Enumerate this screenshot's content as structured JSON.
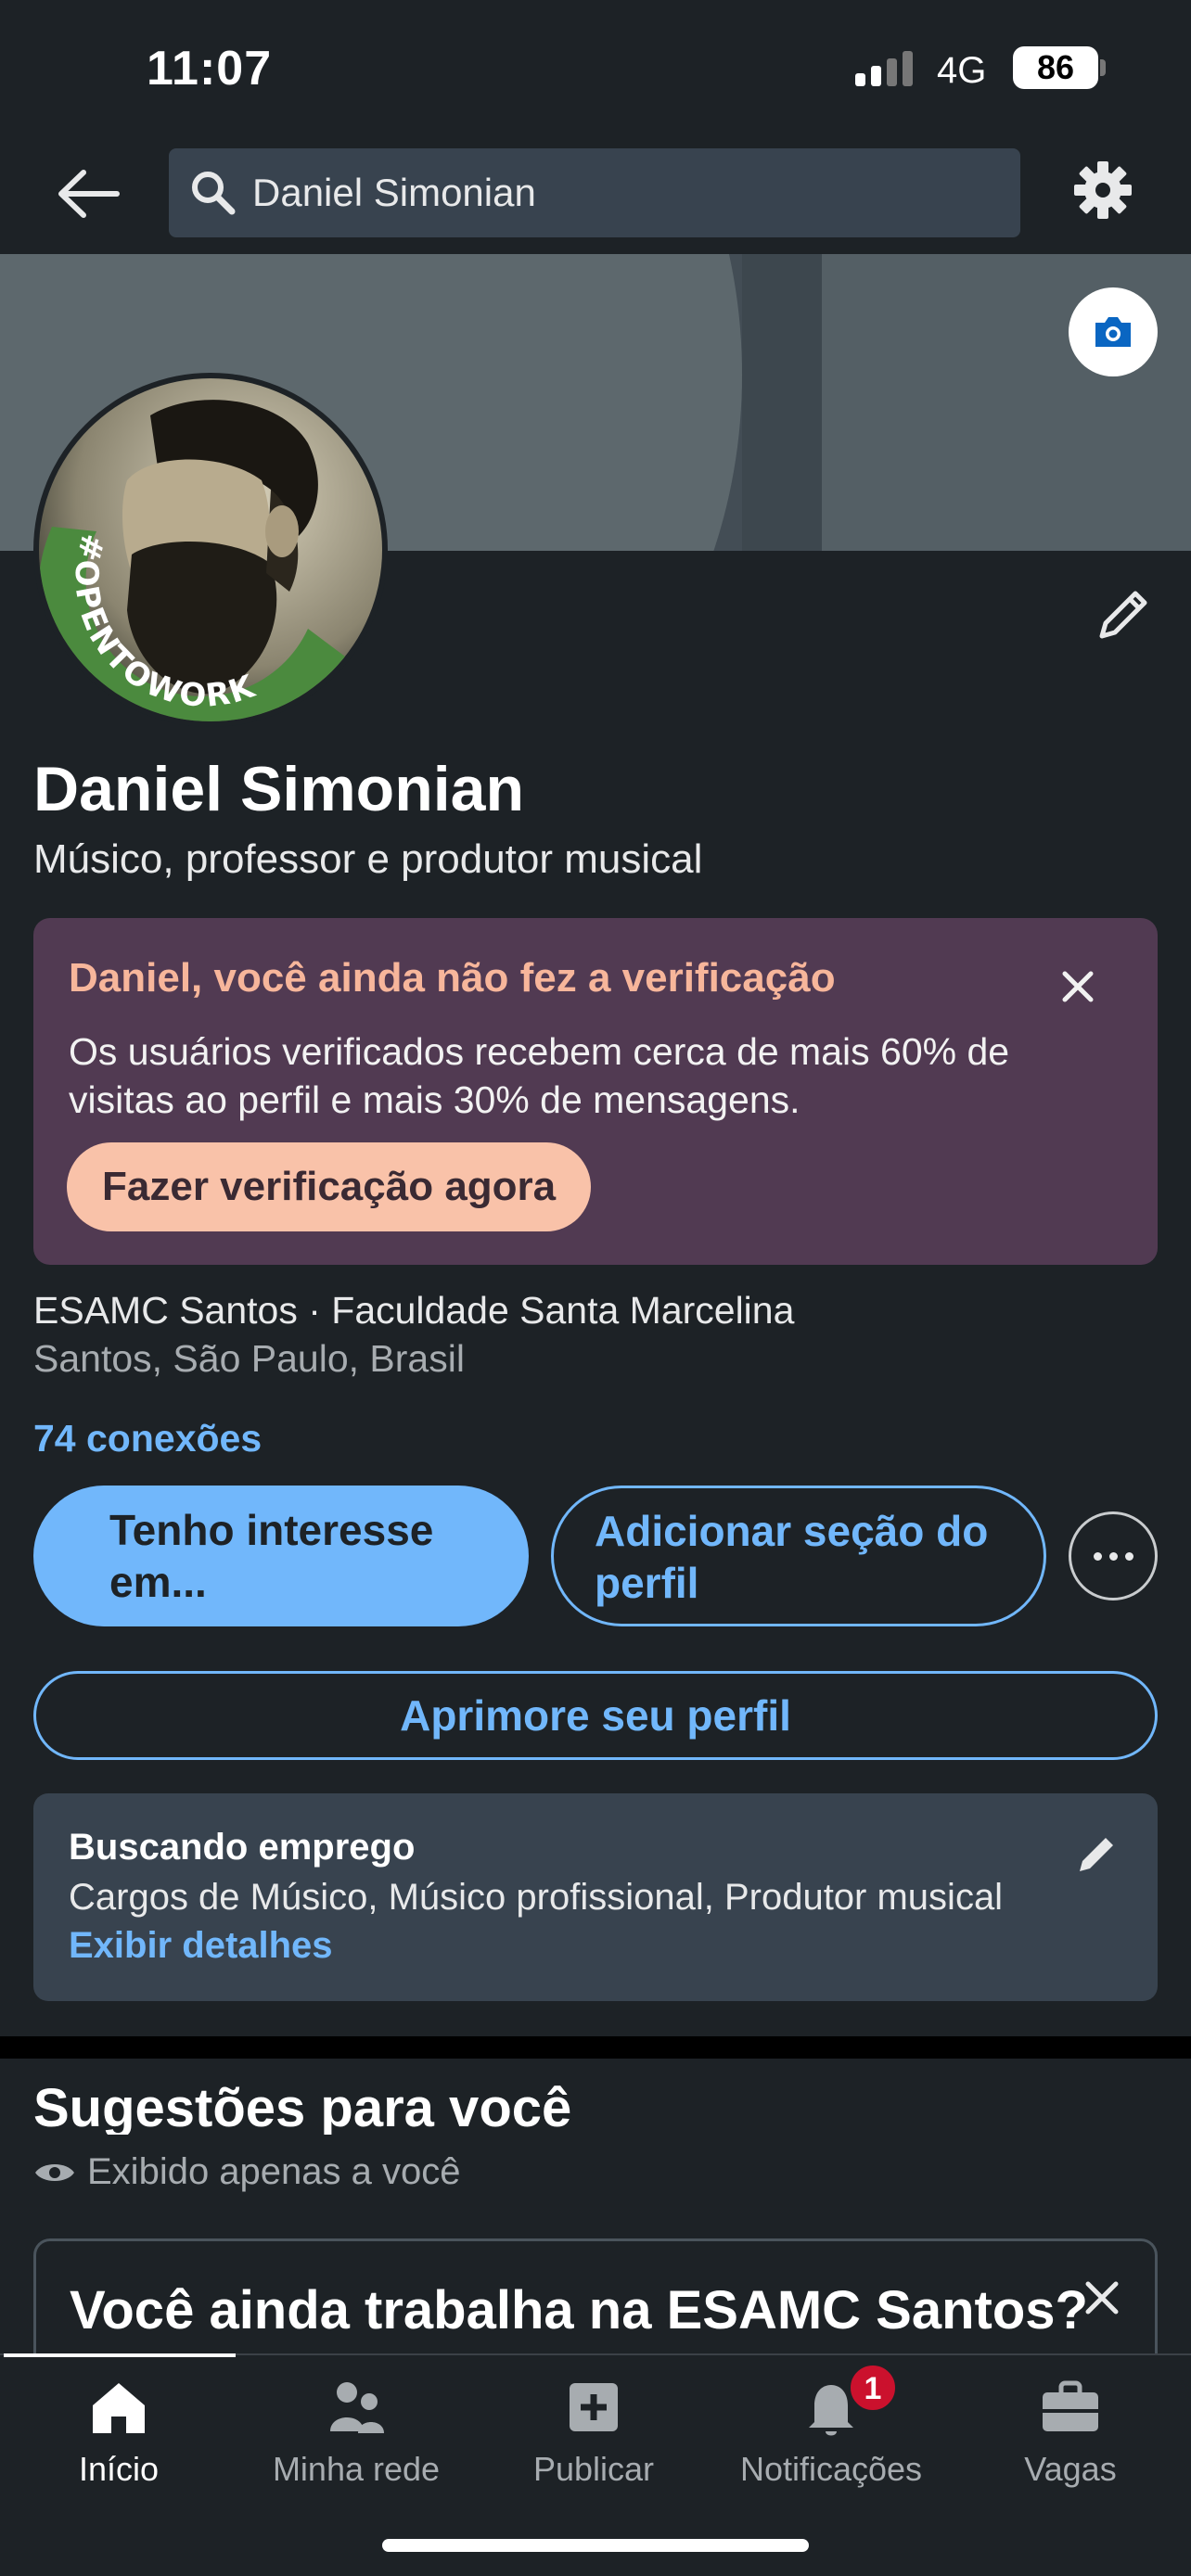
{
  "status_bar": {
    "time": "11:07",
    "network": "4G",
    "battery": "86"
  },
  "search": {
    "value": "Daniel Simonian"
  },
  "profile": {
    "name": "Daniel Simonian",
    "headline": "Músico, professor e produtor musical",
    "open_to_work_frame": "#OPENTOWORK",
    "education": "ESAMC Santos · Faculdade Santa Marcelina",
    "location": "Santos, São Paulo, Brasil",
    "connections": "74 conexões"
  },
  "verification": {
    "title": "Daniel, você ainda não fez a verificação",
    "text": "Os usuários verificados recebem cerca de mais 60% de visitas ao perfil e mais 30% de mensagens.",
    "button": "Fazer verificação agora"
  },
  "actions": {
    "interest": "Tenho interesse em...",
    "add_section": "Adicionar seção do perfil",
    "improve": "Aprimore seu perfil"
  },
  "open_to_work": {
    "title": "Buscando emprego",
    "roles": "Cargos de Músico, Músico profissional, Produtor musical",
    "details_link": "Exibir detalhes"
  },
  "suggestions": {
    "title": "Sugestões para você",
    "visibility": "Exibido apenas a você",
    "card_title": "Você ainda trabalha na ESAMC Santos?"
  },
  "tabs": [
    {
      "label": "Início",
      "icon": "home-icon"
    },
    {
      "label": "Minha rede",
      "icon": "people-icon"
    },
    {
      "label": "Publicar",
      "icon": "plus-square-icon"
    },
    {
      "label": "Notificações",
      "icon": "bell-icon",
      "badge": "1"
    },
    {
      "label": "Vagas",
      "icon": "briefcase-icon"
    }
  ],
  "colors": {
    "background": "#1d2226",
    "link_blue": "#71b7fb",
    "verification_bg": "#513a52",
    "verification_accent": "#f7b69b",
    "open_to_work_green": "#4b8a3e",
    "badge_red": "#cb112d"
  }
}
